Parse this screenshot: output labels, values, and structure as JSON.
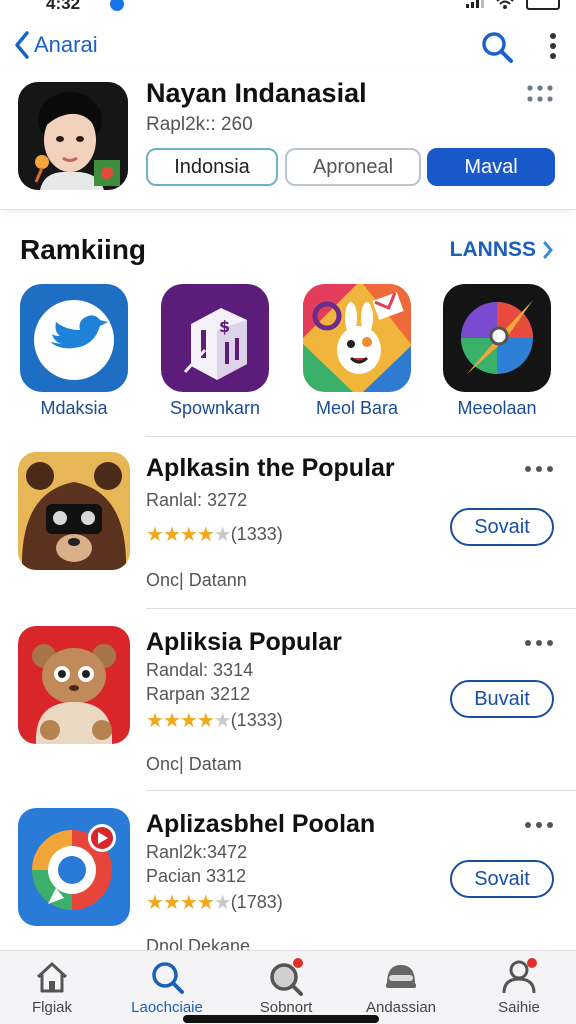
{
  "status": {
    "time": "4:32"
  },
  "nav": {
    "back_label": "Anarai"
  },
  "header": {
    "title": "Nayan Indanasial",
    "subtitle": "Rapl2k:: 260",
    "segments": [
      "Indonsia",
      "Aproneal",
      "Maval"
    ]
  },
  "ranking": {
    "title": "Ramkiing",
    "link": "LANNSS",
    "items": [
      {
        "label": "Mdaksia"
      },
      {
        "label": "Spownkarn"
      },
      {
        "label": "Meol Bara"
      },
      {
        "label": "Meeolaan"
      }
    ]
  },
  "list": [
    {
      "title": "Aplkasin the Popular",
      "line1": "Ranlal: 3272",
      "line2": "",
      "rating_count": "(1333)",
      "rating": 3.5,
      "foot": "Onc| Datann",
      "button": "Sovait"
    },
    {
      "title": "Apliksia Popular",
      "line1": "Randal: 3314",
      "line2": "Rarpan 3212",
      "rating_count": "(1333)",
      "rating": 3.5,
      "foot": "Onc| Datam",
      "button": "Buvait"
    },
    {
      "title": "Aplizasbhel Poolan",
      "line1": "Ranl2k:3472",
      "line2": "Pacian 3312",
      "rating_count": "(1783)",
      "rating": 3.5,
      "foot": "Dnol Dekane",
      "button": "Sovait"
    }
  ],
  "tabs": [
    {
      "label": "Flgiak",
      "icon": "home-icon"
    },
    {
      "label": "Laochciaie",
      "icon": "search-icon"
    },
    {
      "label": "Sobnort",
      "icon": "magnifier-badge-icon"
    },
    {
      "label": "Andassian",
      "icon": "helmet-icon"
    },
    {
      "label": "Saihie",
      "icon": "person-icon"
    }
  ],
  "colors": {
    "accent": "#1958c9",
    "link": "#1a5fb8",
    "star": "#f0a81c"
  }
}
